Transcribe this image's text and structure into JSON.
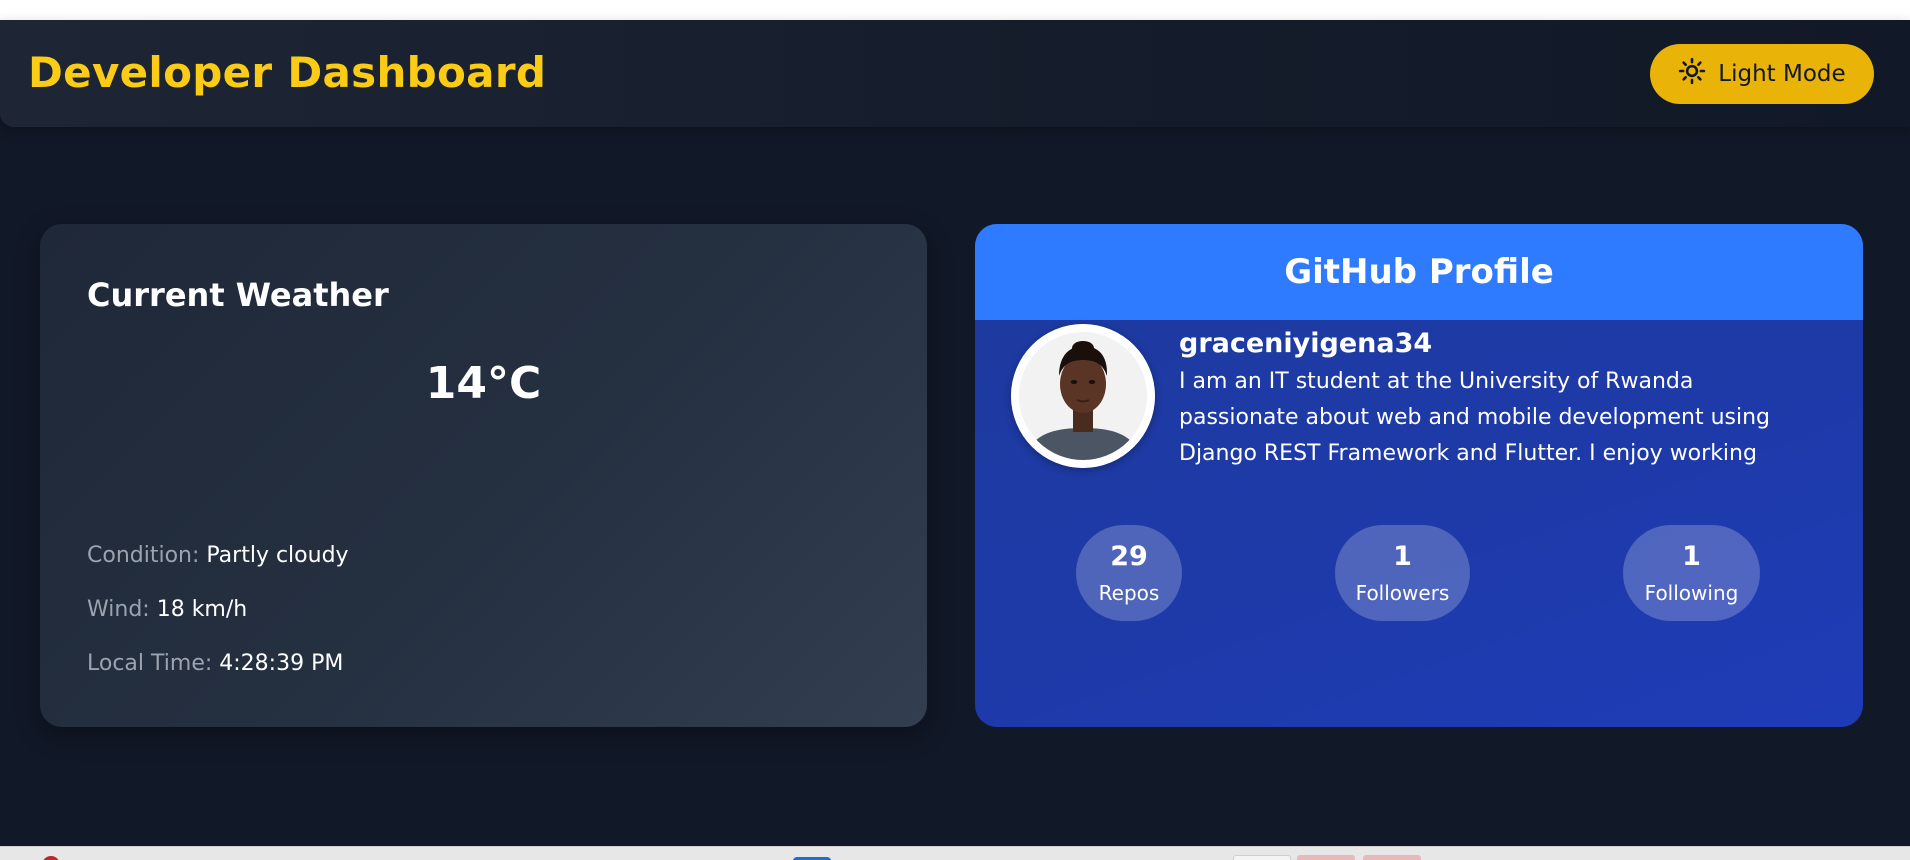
{
  "header": {
    "title": "Developer Dashboard",
    "theme_toggle": {
      "label": "Light Mode",
      "icon": "sun-icon"
    }
  },
  "weather": {
    "title": "Current Weather",
    "temperature": "14°C",
    "details": [
      {
        "label": "Condition:",
        "value": "Partly cloudy"
      },
      {
        "label": "Wind:",
        "value": "18 km/h"
      },
      {
        "label": "Local Time:",
        "value": "4:28:39 PM"
      }
    ]
  },
  "github": {
    "title": "GitHub Profile",
    "username": "graceniyigena34",
    "bio": "I am an IT student at the University of Rwanda passionate about web and mobile development using Django REST Framework and Flutter. I enjoy working",
    "stats": [
      {
        "count": "29",
        "label": "Repos"
      },
      {
        "count": "1",
        "label": "Followers"
      },
      {
        "count": "1",
        "label": "Following"
      }
    ]
  },
  "colors": {
    "page_background": "#111827",
    "accent_yellow": "#facc15",
    "toggle_button": "#eab308",
    "github_header": "#2e7bff",
    "github_card": "#1e3aa8"
  }
}
